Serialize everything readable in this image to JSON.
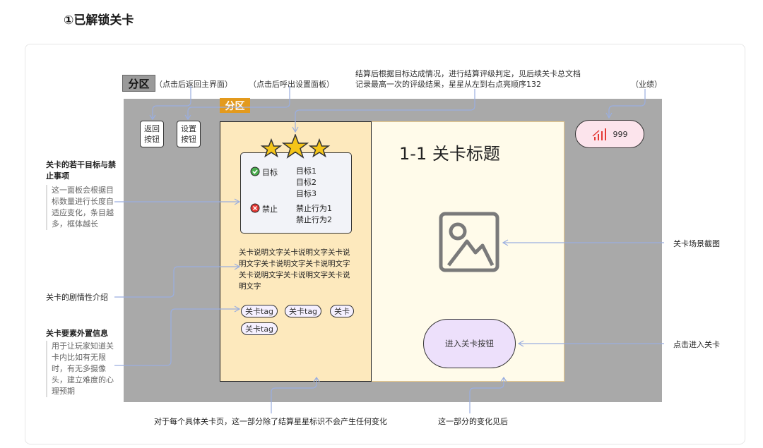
{
  "heading": "①已解锁关卡",
  "top": {
    "fenqu_box": "分区",
    "note_return": "（点击后返回主界面）",
    "note_settings": "（点击后呼出设置面板）",
    "note_rating_line1": "结算后根据目标达成情况，进行结算评级判定，见后续关卡总文档",
    "note_rating_line2": "记录最高一次的评级结果，星星从左到右点亮顺序132",
    "note_score": "（业绩）"
  },
  "ui": {
    "fenqu_tag": "分区",
    "return_btn": [
      "返回",
      "按钮"
    ],
    "settings_btn": [
      "设置",
      "按钮"
    ],
    "goals_label": "目标",
    "goals": [
      "目标1",
      "目标2",
      "目标3"
    ],
    "ban_label": "禁止",
    "bans": [
      "禁止行为1",
      "禁止行为2"
    ],
    "description": "关卡说明文字关卡说明文字关卡说明文字关卡说明文字关卡说明文字关卡说明文字关卡说明文字关卡说明文字",
    "tags": [
      "关卡tag",
      "关卡tag",
      "关卡",
      "关卡tag"
    ],
    "level_title": "1-1  关卡标题",
    "enter_button": "进入关卡按钮",
    "score": "999"
  },
  "annotations": {
    "goals_title": "关卡的若干目标与禁止事项",
    "goals_desc": "这一面板会根据目标数量进行长度自适应变化，条目越多，框体越长",
    "story": "关卡的剧情性介绍",
    "elements_title": "关卡要素外置信息",
    "elements_desc": "用于让玩家知道关卡内比如有无限时，有无多摄像头，建立难度的心理预期",
    "scene": "关卡场景截图",
    "enter": "点击进入关卡",
    "bottom_left": "对于每个具体关卡页，这一部分除了结算星星标识不会产生任何变化",
    "bottom_right": "这一部分的变化见后"
  },
  "colors": {
    "gray_bg": "#a9a9a9",
    "left_panel": "#fde9bd",
    "right_panel": "#fffbea",
    "orange": "#e39a1d",
    "star": "#f5c518",
    "connector": "#9aaee0",
    "enter_btn": "#ede0fb",
    "score_pill": "#fce4ec",
    "goal_icon": "#4caf50",
    "ban_icon": "#e53935"
  }
}
